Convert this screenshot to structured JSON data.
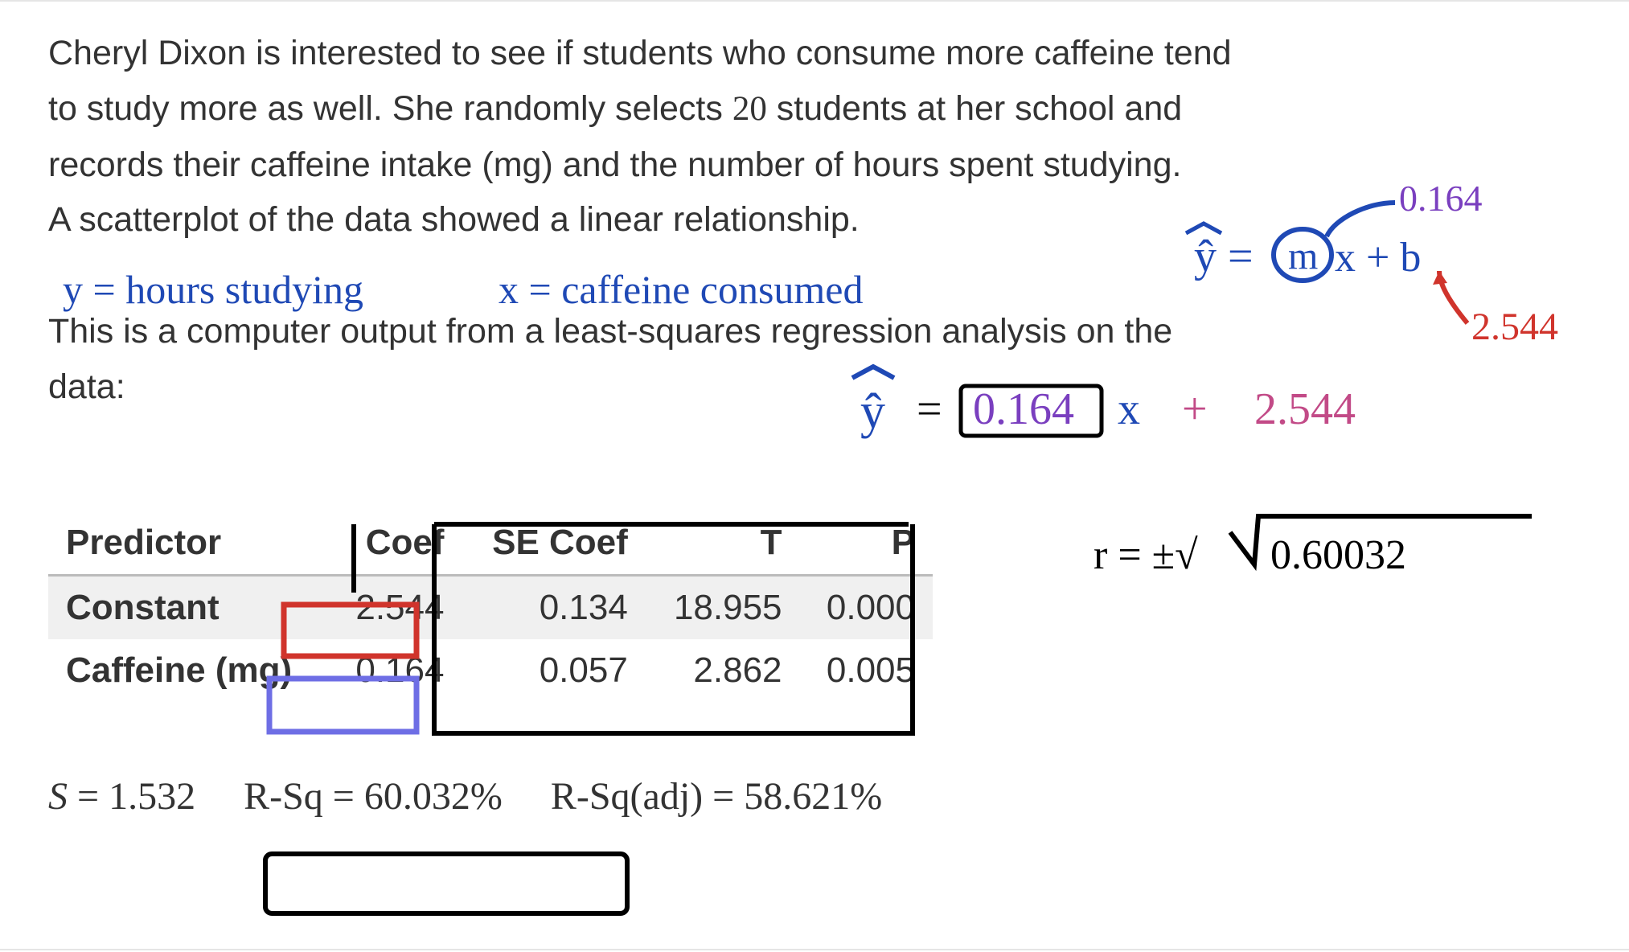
{
  "problem": {
    "line1": "Cheryl Dixon is interested to see if students who consume more caffeine tend",
    "line2a": "to study more as well. She randomly selects ",
    "line2_num": "20",
    "line2b": " students at her school and",
    "line3": "records their caffeine intake (mg) and the number of hours spent studying.",
    "line4": "A scatterplot of the data showed a linear relationship.",
    "line5": "This is a computer output from a least-squares regression analysis on the",
    "line6": "data:"
  },
  "annotations": {
    "y_def": "y = hours studying",
    "x_def": "x = caffeine consumed",
    "model_yhat": "ŷ =",
    "model_m": "m",
    "model_x": "x + b",
    "m_val": "0.164",
    "b_val": "2.544",
    "eq_yhat": "ŷ",
    "eq_eq": "=",
    "eq_slope": "0.164",
    "eq_x": "x",
    "eq_plus": "+",
    "eq_intercept": "2.544",
    "r_expr": "r = ±√",
    "r_val": "0.60032"
  },
  "table": {
    "headers": {
      "predictor": "Predictor",
      "coef": "Coef",
      "se": "SE Coef",
      "t": "T",
      "p": "P"
    },
    "rows": [
      {
        "predictor": "Constant",
        "coef": "2.544",
        "se": "0.134",
        "t": "18.955",
        "p": "0.000"
      },
      {
        "predictor": "Caffeine (mg)",
        "coef": "0.164",
        "se": "0.057",
        "t": "2.862",
        "p": "0.005"
      }
    ]
  },
  "stats": {
    "s_label": "S",
    "s_eq": " = ",
    "s_val": "1.532",
    "rsq_label": "R-Sq",
    "rsq_val": " = 60.032%",
    "rsq_adj_label": "R-Sq(adj)",
    "rsq_adj_val": " = 58.621%"
  },
  "colors": {
    "blue": "#1f49b5",
    "red": "#d0342c",
    "purple": "#7a3fbf",
    "magenta": "#c24a87",
    "black": "#000000"
  }
}
